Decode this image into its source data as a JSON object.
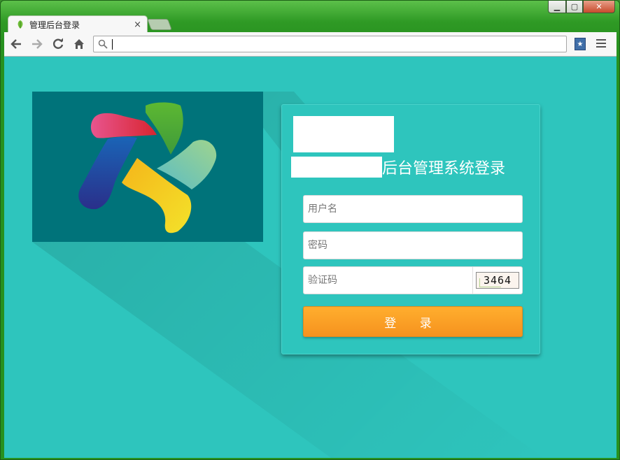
{
  "browser": {
    "tab_title": "管理后台登录",
    "tab_close": "×",
    "address_value": "",
    "window_buttons": {
      "minimize": "▁",
      "maximize": "▢",
      "close": "✕"
    }
  },
  "icons": {
    "back": "back-arrow-icon",
    "forward": "forward-arrow-icon",
    "reload": "reload-icon",
    "home": "home-icon",
    "search": "search-icon",
    "bookmark": "bookmark-extension-icon",
    "menu": "hamburger-menu-icon",
    "favicon": "leaf-favicon-icon"
  },
  "login": {
    "title_suffix": "后台管理系统登录",
    "username_placeholder": "用户名",
    "password_placeholder": "密码",
    "captcha_placeholder": "验证码",
    "captcha_code": "3464",
    "submit_label": "登 录"
  },
  "colors": {
    "page_background": "#2ec5bd",
    "logo_panel": "#00737a",
    "login_button": "#f7931e",
    "window_frame": "#2f9a25"
  }
}
